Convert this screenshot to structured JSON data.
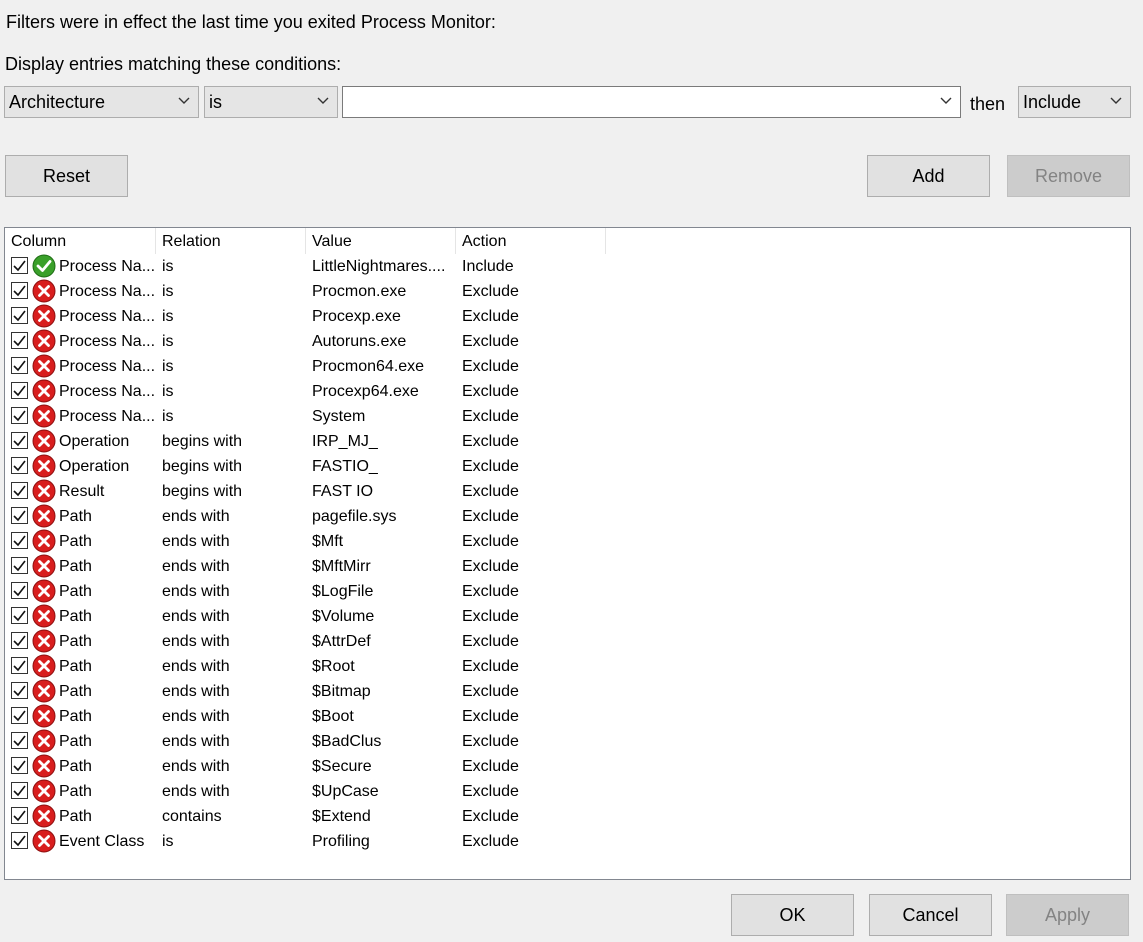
{
  "header": {
    "filters_notice": "Filters were in effect the last time you exited Process Monitor:",
    "conditions_label": "Display entries matching these conditions:"
  },
  "filter_bar": {
    "column_value": "Architecture",
    "relation_value": "is",
    "value_value": "",
    "then_label": "then",
    "action_value": "Include"
  },
  "buttons": {
    "reset": "Reset",
    "add": "Add",
    "remove": "Remove",
    "ok": "OK",
    "cancel": "Cancel",
    "apply": "Apply"
  },
  "table": {
    "columns": [
      "Column",
      "Relation",
      "Value",
      "Action"
    ],
    "rows": [
      {
        "checked": true,
        "status": "include",
        "column": "Process Na...",
        "relation": "is",
        "value": "LittleNightmares....",
        "action": "Include"
      },
      {
        "checked": true,
        "status": "exclude",
        "column": "Process Na...",
        "relation": "is",
        "value": "Procmon.exe",
        "action": "Exclude"
      },
      {
        "checked": true,
        "status": "exclude",
        "column": "Process Na...",
        "relation": "is",
        "value": "Procexp.exe",
        "action": "Exclude"
      },
      {
        "checked": true,
        "status": "exclude",
        "column": "Process Na...",
        "relation": "is",
        "value": "Autoruns.exe",
        "action": "Exclude"
      },
      {
        "checked": true,
        "status": "exclude",
        "column": "Process Na...",
        "relation": "is",
        "value": "Procmon64.exe",
        "action": "Exclude"
      },
      {
        "checked": true,
        "status": "exclude",
        "column": "Process Na...",
        "relation": "is",
        "value": "Procexp64.exe",
        "action": "Exclude"
      },
      {
        "checked": true,
        "status": "exclude",
        "column": "Process Na...",
        "relation": "is",
        "value": "System",
        "action": "Exclude"
      },
      {
        "checked": true,
        "status": "exclude",
        "column": "Operation",
        "relation": "begins with",
        "value": "IRP_MJ_",
        "action": "Exclude"
      },
      {
        "checked": true,
        "status": "exclude",
        "column": "Operation",
        "relation": "begins with",
        "value": "FASTIO_",
        "action": "Exclude"
      },
      {
        "checked": true,
        "status": "exclude",
        "column": "Result",
        "relation": "begins with",
        "value": "FAST IO",
        "action": "Exclude"
      },
      {
        "checked": true,
        "status": "exclude",
        "column": "Path",
        "relation": "ends with",
        "value": "pagefile.sys",
        "action": "Exclude"
      },
      {
        "checked": true,
        "status": "exclude",
        "column": "Path",
        "relation": "ends with",
        "value": "$Mft",
        "action": "Exclude"
      },
      {
        "checked": true,
        "status": "exclude",
        "column": "Path",
        "relation": "ends with",
        "value": "$MftMirr",
        "action": "Exclude"
      },
      {
        "checked": true,
        "status": "exclude",
        "column": "Path",
        "relation": "ends with",
        "value": "$LogFile",
        "action": "Exclude"
      },
      {
        "checked": true,
        "status": "exclude",
        "column": "Path",
        "relation": "ends with",
        "value": "$Volume",
        "action": "Exclude"
      },
      {
        "checked": true,
        "status": "exclude",
        "column": "Path",
        "relation": "ends with",
        "value": "$AttrDef",
        "action": "Exclude"
      },
      {
        "checked": true,
        "status": "exclude",
        "column": "Path",
        "relation": "ends with",
        "value": "$Root",
        "action": "Exclude"
      },
      {
        "checked": true,
        "status": "exclude",
        "column": "Path",
        "relation": "ends with",
        "value": "$Bitmap",
        "action": "Exclude"
      },
      {
        "checked": true,
        "status": "exclude",
        "column": "Path",
        "relation": "ends with",
        "value": "$Boot",
        "action": "Exclude"
      },
      {
        "checked": true,
        "status": "exclude",
        "column": "Path",
        "relation": "ends with",
        "value": "$BadClus",
        "action": "Exclude"
      },
      {
        "checked": true,
        "status": "exclude",
        "column": "Path",
        "relation": "ends with",
        "value": "$Secure",
        "action": "Exclude"
      },
      {
        "checked": true,
        "status": "exclude",
        "column": "Path",
        "relation": "ends with",
        "value": "$UpCase",
        "action": "Exclude"
      },
      {
        "checked": true,
        "status": "exclude",
        "column": "Path",
        "relation": "contains",
        "value": "$Extend",
        "action": "Exclude"
      },
      {
        "checked": true,
        "status": "exclude",
        "column": "Event Class",
        "relation": "is",
        "value": "Profiling",
        "action": "Exclude"
      }
    ]
  },
  "colors": {
    "include_icon": "#3aa02a",
    "exclude_icon": "#d81e1e",
    "disabled_text": "#838383"
  }
}
